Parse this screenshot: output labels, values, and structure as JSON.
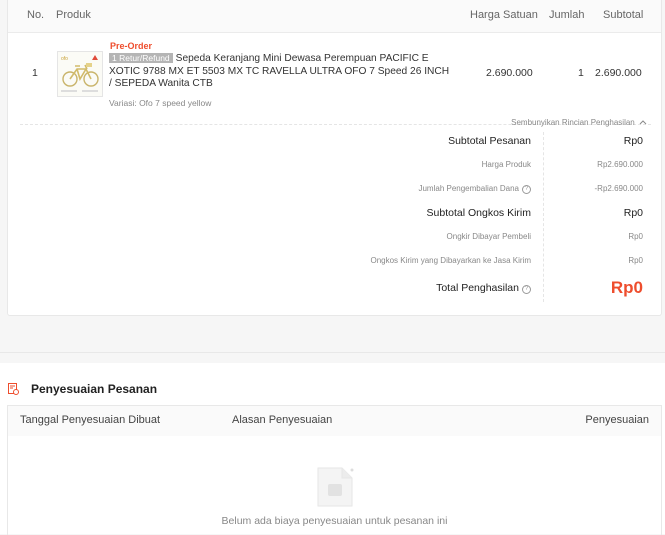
{
  "table_header": {
    "no": "No.",
    "produk": "Produk",
    "harga_satuan": "Harga Satuan",
    "jumlah": "Jumlah",
    "subtotal": "Subtotal"
  },
  "item": {
    "no": "1",
    "badge": "Pre-Order",
    "return_badge": "1 Retur/Refund",
    "name": "Sepeda Keranjang Mini Dewasa Perempuan PACIFIC E XOTIC 9788 MX ET 5503 MX TC RAVELLA ULTRA OFO 7 Speed 26 INCH / SEPEDA Wanita CTB",
    "variasi": "Variasi: Ofo 7 speed yellow",
    "harga_satuan": "2.690.000",
    "jumlah": "1",
    "subtotal": "2.690.000"
  },
  "toggle_details": "Sembunyikan Rincian Penghasilan",
  "breakdown": {
    "subtotal_pesanan_label": "Subtotal Pesanan",
    "subtotal_pesanan_value": "Rp0",
    "harga_produk_label": "Harga Produk",
    "harga_produk_value": "Rp2.690.000",
    "jumlah_pengembalian_label": "Jumlah Pengembalian Dana",
    "jumlah_pengembalian_value": "-Rp2.690.000",
    "subtotal_ongkir_label": "Subtotal Ongkos Kirim",
    "subtotal_ongkir_value": "Rp0",
    "ongkir_pembeli_label": "Ongkir Dibayar Pembeli",
    "ongkir_pembeli_value": "Rp0",
    "ongkir_jasa_label": "Ongkos Kirim yang Dibayarkan ke Jasa Kirim",
    "ongkir_jasa_value": "Rp0",
    "total_label": "Total Penghasilan",
    "total_value": "Rp0"
  },
  "adjustment": {
    "title": "Penyesuaian Pesanan",
    "col_tanggal": "Tanggal Penyesuaian Dibuat",
    "col_alasan": "Alasan Penyesuaian",
    "col_penyesuaian": "Penyesuaian",
    "empty_text": "Belum ada biaya penyesuaian untuk pesanan ini"
  },
  "colors": {
    "accent": "#ee4d2d"
  }
}
